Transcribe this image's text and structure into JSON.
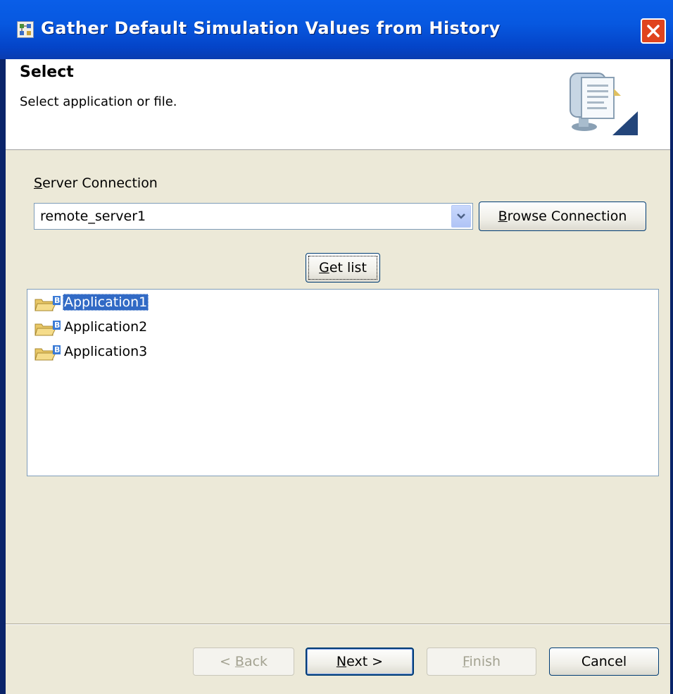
{
  "window": {
    "title": "Gather Default Simulation Values from History"
  },
  "header": {
    "title": "Select",
    "description": "Select application or file."
  },
  "form": {
    "server_label_mnemonic": "S",
    "server_label_rest": "erver Connection",
    "server_value": "remote_server1",
    "browse_mnemonic": "B",
    "browse_rest": "rowse Connection",
    "getlist_mnemonic": "G",
    "getlist_rest": "et list"
  },
  "tree": {
    "items": [
      {
        "label": "Application1",
        "selected": true
      },
      {
        "label": "Application2",
        "selected": false
      },
      {
        "label": "Application3",
        "selected": false
      }
    ]
  },
  "footer": {
    "back_prefix": "< ",
    "back_mnemonic": "B",
    "back_rest": "ack",
    "next_mnemonic": "N",
    "next_rest": "ext >",
    "finish_mnemonic": "F",
    "finish_rest": "inish",
    "cancel": "Cancel"
  },
  "colors": {
    "titlebar": "#0758e0",
    "selection": "#316ac5",
    "face": "#ece9d8"
  },
  "icons": {
    "title": "wizard-icon",
    "close": "close-icon",
    "header": "wizard-banner-icon",
    "combo": "chevron-down-icon",
    "item": "folder-application-icon"
  }
}
